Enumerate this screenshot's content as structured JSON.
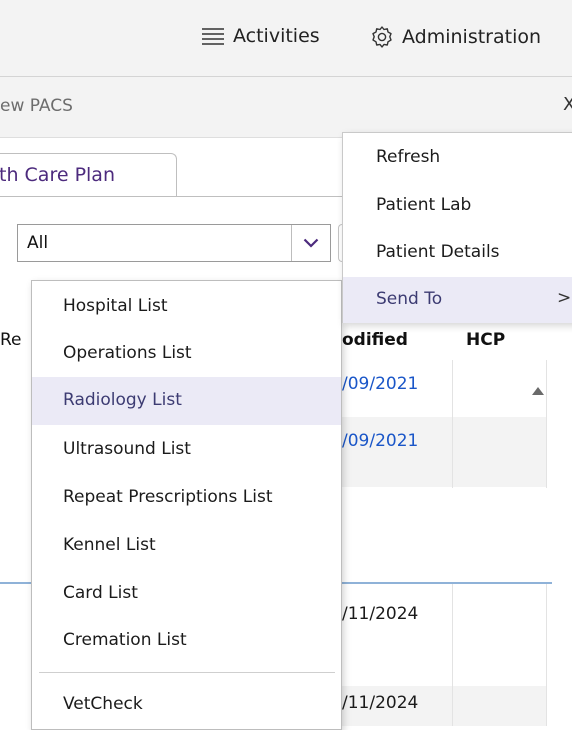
{
  "topbar": {
    "activities_label": "Activities",
    "administration_label": "Administration"
  },
  "subbar": {
    "title": "ew PACS",
    "close_glyph": "X"
  },
  "tab": {
    "label": "th Care Plan"
  },
  "filter": {
    "selected": "All"
  },
  "table": {
    "headers": {
      "re": "Re",
      "modified": "odified",
      "hcp": "HCP"
    },
    "dates": [
      "/09/2021",
      "/09/2021",
      "/11/2024",
      "/11/2024"
    ],
    "link_color": "#1a56c8"
  },
  "dropdown": {
    "items": [
      "Hospital List",
      "Operations List",
      "Radiology List",
      "Ultrasound List",
      "Repeat Prescriptions List",
      "Kennel List",
      "Card List",
      "Cremation List",
      "VetCheck"
    ],
    "highlighted": "Radiology List"
  },
  "context_menu": {
    "items": [
      "Refresh",
      "Patient Lab",
      "Patient Details",
      "Send To"
    ],
    "submenu_chevron": ">",
    "highlighted": "Send To"
  },
  "icons": {
    "activities": "list-lines-icon",
    "administration": "gear-icon",
    "dropdown": "chevron-down-icon"
  },
  "colors": {
    "accent_purple": "#4c2a7d",
    "highlight_bg": "#ebeaf6",
    "separator_blue": "#8fb2d8"
  }
}
